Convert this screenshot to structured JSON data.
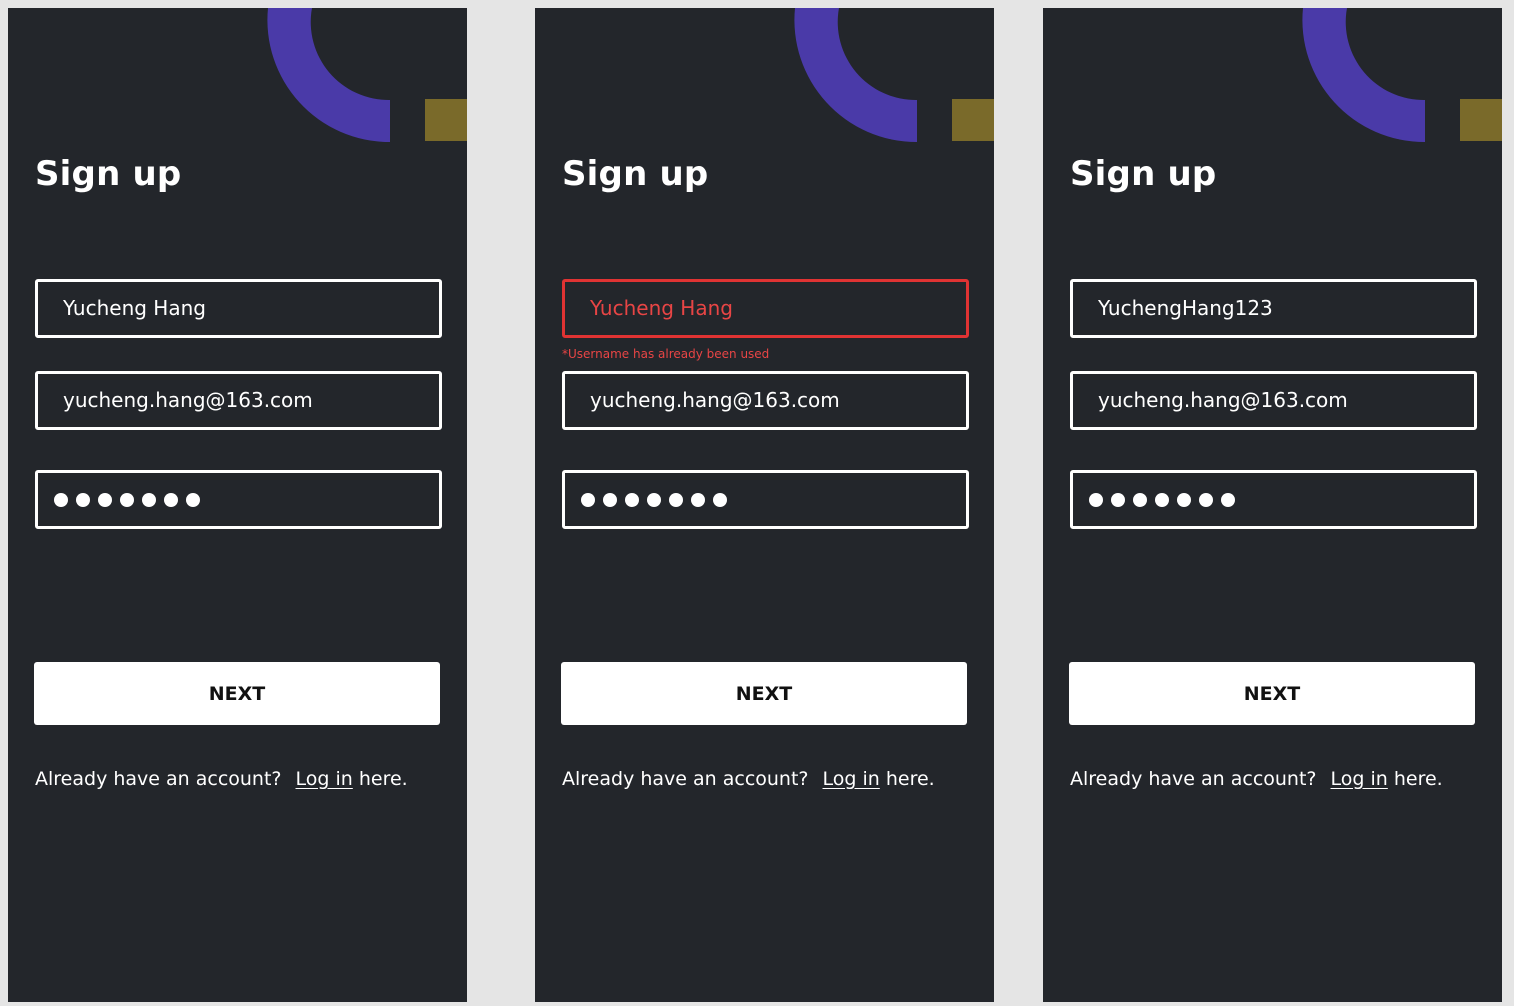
{
  "colors": {
    "frame_bg": "#23262b",
    "canvas_bg": "#e5e5e5",
    "accent_purple": "#4a3aa8",
    "accent_gold": "#7a6a2a",
    "error": "#e84545",
    "text": "#ffffff"
  },
  "screens": [
    {
      "title": "Sign up",
      "username": "Yucheng Hang",
      "username_error": "",
      "email": "yucheng.hang@163.com",
      "password_length": 7,
      "next_label": "NEXT",
      "footer_prompt": "Already have an account?",
      "footer_link": "Log in",
      "footer_suffix": " here."
    },
    {
      "title": "Sign up",
      "username": "Yucheng Hang",
      "username_error": "*Username has already been used",
      "email": "yucheng.hang@163.com",
      "password_length": 7,
      "next_label": "NEXT",
      "footer_prompt": "Already have an account?",
      "footer_link": "Log in",
      "footer_suffix": " here."
    },
    {
      "title": "Sign up",
      "username": "YuchengHang123",
      "username_error": "",
      "email": "yucheng.hang@163.com",
      "password_length": 7,
      "next_label": "NEXT",
      "footer_prompt": "Already have an account?",
      "footer_link": "Log in",
      "footer_suffix": " here."
    }
  ]
}
